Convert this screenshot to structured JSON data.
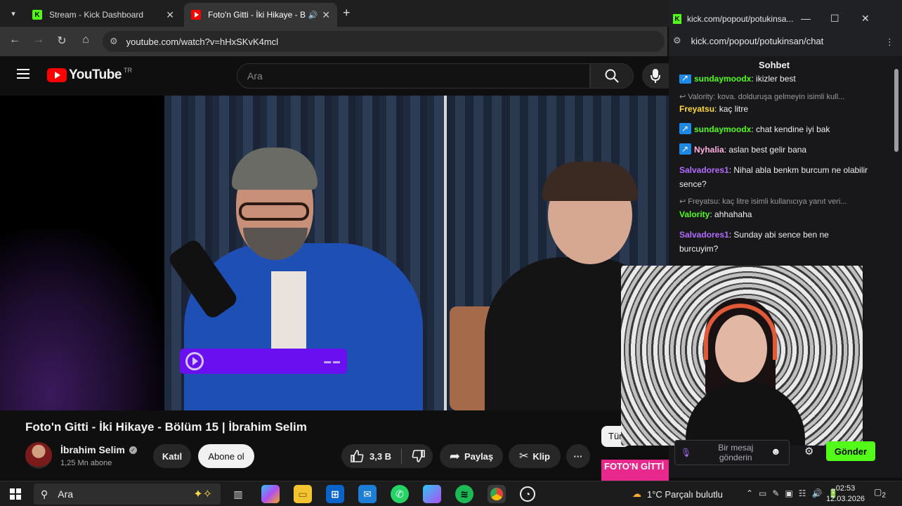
{
  "browser": {
    "tabs": [
      {
        "title": "Stream - Kick Dashboard",
        "favicon": "kick-icon"
      },
      {
        "title": "Foto'n Gitti - İki Hikaye - Bö",
        "favicon": "youtube-icon",
        "active": true
      }
    ],
    "address": "youtube.com/watch?v=hHxSKvK4mcl"
  },
  "youtube": {
    "logo_text": "YouTube",
    "region": "TR",
    "search_placeholder": "Ara",
    "video": {
      "title": "Foto'n Gitti - İki Hikaye - Bölüm 15 | İbrahim Selim",
      "channel": "İbrahim Selim",
      "subscribers": "1,25 Mn abone",
      "join_label": "Katıl",
      "subscribe_label": "Abone ol",
      "likes": "3,3 B",
      "share_label": "Paylaş",
      "clip_label": "Klip"
    },
    "chip_partial": "Tür",
    "thumb_text": "FOTO'N GİTTİ"
  },
  "popout": {
    "window_title": "kick.com/popout/potukinsa...",
    "address": "kick.com/popout/potukinsan/chat",
    "chat_title": "Sohbet",
    "messages": [
      {
        "user": "sundaymoodx",
        "text": "ikizler best",
        "color": "#53fc18",
        "badge": true,
        "partial": true
      },
      {
        "reply": "Valority: kova. dolduruşa gelmeyin isimli kull..."
      },
      {
        "user": "Freyatsu",
        "text": "kaç litre",
        "color": "#ffd83b"
      },
      {
        "user": "sundaymoodx",
        "text": "chat kendine iyi bak",
        "color": "#53fc18",
        "badge": true
      },
      {
        "user": "Nyhalia",
        "text": "aslan best gelir bana",
        "color": "#ffb0e0",
        "badge": true
      },
      {
        "user": "Salvadores1",
        "text": "Nihal abla benkm burcum ne olabilir sence?",
        "color": "#b46cff"
      },
      {
        "reply": "Freyatsu: kaç litre isimli kullanıcıya yanıt veri..."
      },
      {
        "user": "Valority",
        "text": "ahhahaha",
        "color": "#53fc18"
      },
      {
        "user": "Salvadores1",
        "text": "Sunday abi sence ben ne burcuyim?",
        "color": "#b46cff"
      }
    ],
    "input_placeholder": "Bir mesaj gönderin",
    "send_label": "Gönder",
    "accent": "#53fc18"
  },
  "taskbar": {
    "search_placeholder": "Ara",
    "weather": "1°C  Parçalı bulutlu",
    "time": "02:53",
    "date": "12.03.2026",
    "notifications": "2"
  }
}
